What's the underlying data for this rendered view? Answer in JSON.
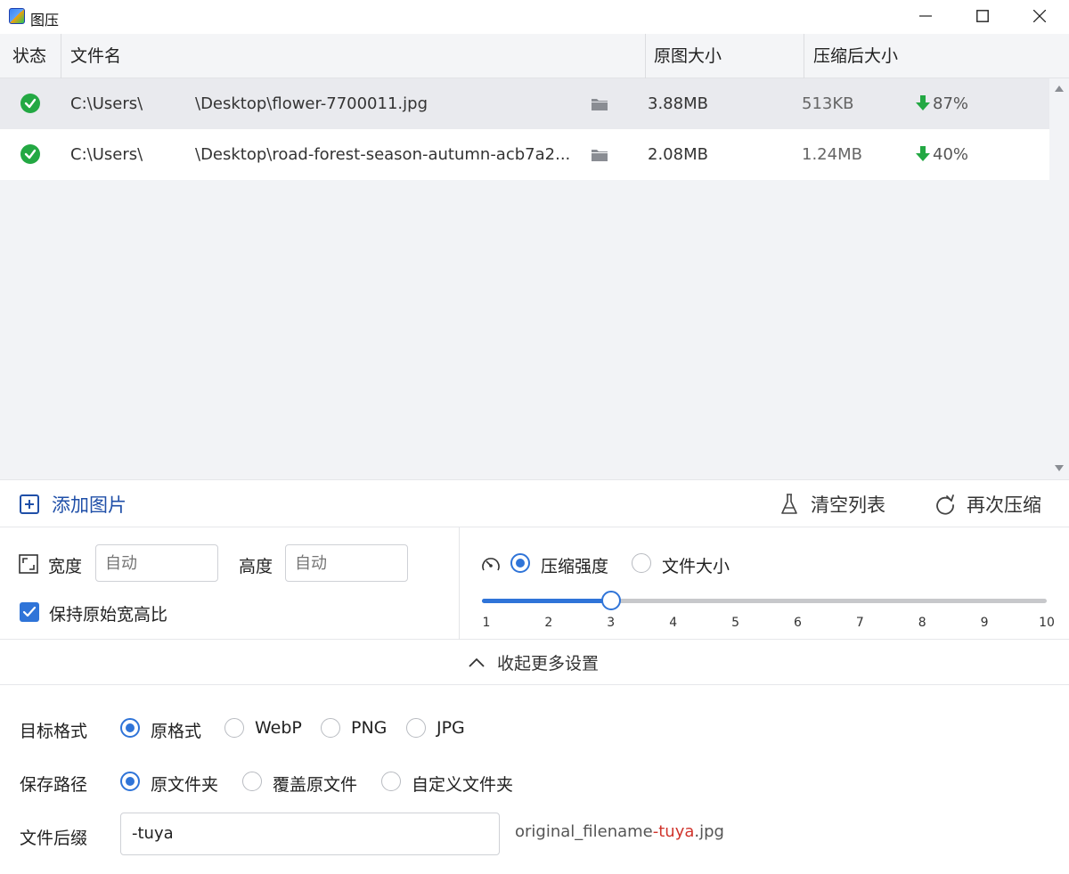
{
  "window": {
    "title": "图压"
  },
  "table": {
    "headers": {
      "status": "状态",
      "filename": "文件名",
      "original_size": "原图大小",
      "compressed_size": "压缩后大小"
    },
    "rows": [
      {
        "status": "done",
        "path_prefix": "C:\\Users\\",
        "path_suffix": "\\Desktop\\flower-7700011.jpg",
        "original": "3.88MB",
        "compressed": "513KB",
        "ratio": "87%"
      },
      {
        "status": "done",
        "path_prefix": "C:\\Users\\",
        "path_suffix": "\\Desktop\\road-forest-season-autumn-acb7a2...",
        "original": "2.08MB",
        "compressed": "1.24MB",
        "ratio": "40%"
      }
    ]
  },
  "actions": {
    "add": "添加图片",
    "clear": "清空列表",
    "recompress": "再次压缩"
  },
  "resize": {
    "width_label": "宽度",
    "width_placeholder": "自动",
    "height_label": "高度",
    "height_placeholder": "自动",
    "keep_ratio": "保持原始宽高比",
    "keep_ratio_checked": true
  },
  "compress": {
    "mode_strength": "压缩强度",
    "mode_filesize": "文件大小",
    "selected_mode": "压缩强度",
    "slider_value": 3,
    "slider_min": 1,
    "slider_max": 10,
    "ticks": [
      "1",
      "2",
      "3",
      "4",
      "5",
      "6",
      "7",
      "8",
      "9",
      "10"
    ]
  },
  "collapse": {
    "label": "收起更多设置"
  },
  "format": {
    "label": "目标格式",
    "options": [
      "原格式",
      "WebP",
      "PNG",
      "JPG"
    ],
    "selected": "原格式"
  },
  "save_path": {
    "label": "保存路径",
    "options": [
      "原文件夹",
      "覆盖原文件",
      "自定义文件夹"
    ],
    "selected": "原文件夹"
  },
  "suffix": {
    "label": "文件后缀",
    "value": "-tuya",
    "preview_base": "original_filename",
    "preview_suffix": "-tuya",
    "preview_ext": ".jpg"
  },
  "colors": {
    "accent": "#2f74d8",
    "success": "#23a843",
    "suffix_highlight": "#d0342c"
  }
}
